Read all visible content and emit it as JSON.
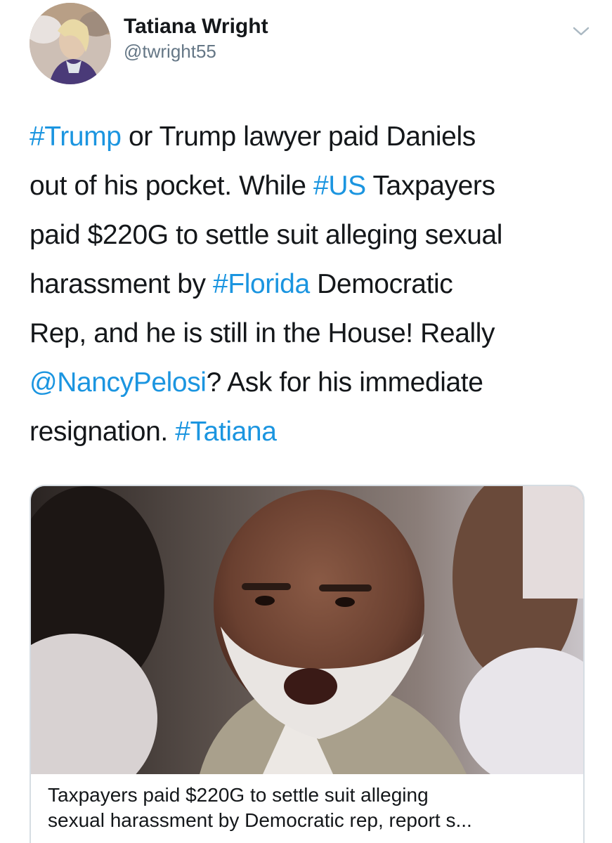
{
  "user": {
    "display_name": "Tatiana Wright",
    "handle": "@twright55",
    "avatar_icon": "profile-photo"
  },
  "menu": {
    "icon": "chevron-down-icon"
  },
  "tweet": {
    "lines": [
      [
        {
          "text": "#Trump",
          "type": "hashtag"
        },
        {
          "text": " or Trump lawyer paid Daniels",
          "type": "text"
        }
      ],
      [
        {
          "text": "out of his pocket. While ",
          "type": "text"
        },
        {
          "text": "#US",
          "type": "hashtag"
        },
        {
          "text": " Taxpayers",
          "type": "text"
        }
      ],
      [
        {
          "text": "paid $220G to settle suit alleging sexual",
          "type": "text"
        }
      ],
      [
        {
          "text": "harassment by ",
          "type": "text"
        },
        {
          "text": "#Florida",
          "type": "hashtag"
        },
        {
          "text": " Democratic",
          "type": "text"
        }
      ],
      [
        {
          "text": "Rep, and he is still in the House! Really",
          "type": "text"
        }
      ],
      [
        {
          "text": "@NancyPelosi",
          "type": "mention"
        },
        {
          "text": "? Ask for his immediate",
          "type": "text"
        }
      ],
      [
        {
          "text": "resignation. ",
          "type": "text"
        },
        {
          "text": "#Tatiana",
          "type": "hashtag"
        }
      ]
    ]
  },
  "card": {
    "title_line_1": "Taxpayers paid $220G to settle suit alleging",
    "title_line_2": "sexual harassment by Democratic rep, report s...",
    "image": "news-photo"
  },
  "colors": {
    "link": "#1b95e0",
    "text": "#14171a",
    "secondary": "#657786",
    "border": "#d6dde3"
  }
}
